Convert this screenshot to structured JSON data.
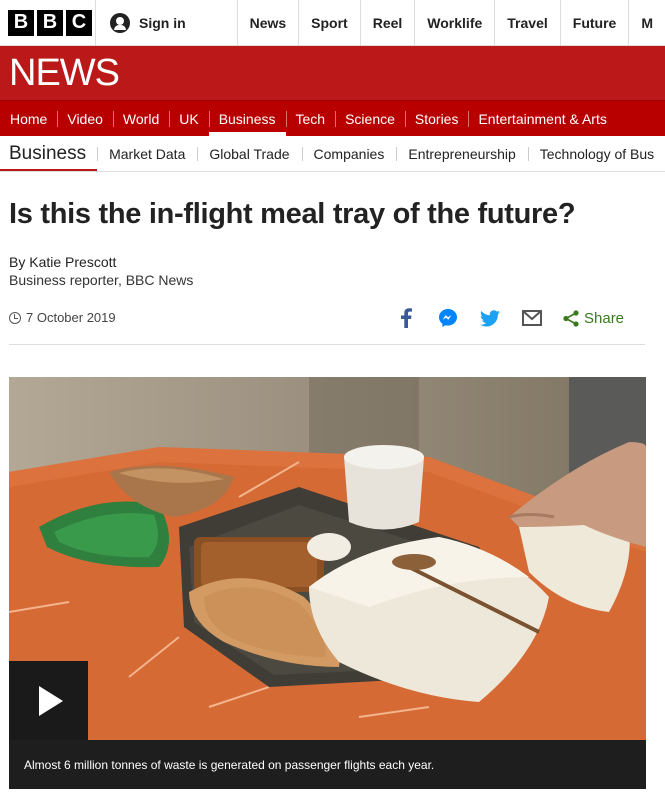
{
  "brand": {
    "logo_letters": [
      "B",
      "B",
      "C"
    ]
  },
  "top_bar": {
    "sign_in": "Sign in",
    "nav": [
      "News",
      "Sport",
      "Reel",
      "Worklife",
      "Travel",
      "Future",
      "M"
    ]
  },
  "banner": {
    "title": "NEWS",
    "color": "#bb1919"
  },
  "main_nav": {
    "items": [
      "Home",
      "Video",
      "World",
      "UK",
      "Business",
      "Tech",
      "Science",
      "Stories",
      "Entertainment & Arts"
    ],
    "active": "Business"
  },
  "sub_nav": {
    "section": "Business",
    "items": [
      "Market Data",
      "Global Trade",
      "Companies",
      "Entrepreneurship",
      "Technology of Bus"
    ]
  },
  "article": {
    "headline": "Is this the in-flight meal tray of the future?",
    "author": "By Katie Prescott",
    "author_role": "Business reporter, BBC News",
    "date": "7 October 2019",
    "share": {
      "icons": [
        "facebook-icon",
        "messenger-icon",
        "twitter-icon",
        "email-icon",
        "share-icon"
      ],
      "label": "Share",
      "colors": {
        "facebook": "#3b5998",
        "messenger": "#0084ff",
        "twitter": "#1da1f2",
        "email": "#555555",
        "share": "#3a7a1e"
      }
    }
  },
  "media": {
    "type": "video",
    "caption": "Almost 6 million tonnes of waste is generated on passenger flights each year."
  }
}
